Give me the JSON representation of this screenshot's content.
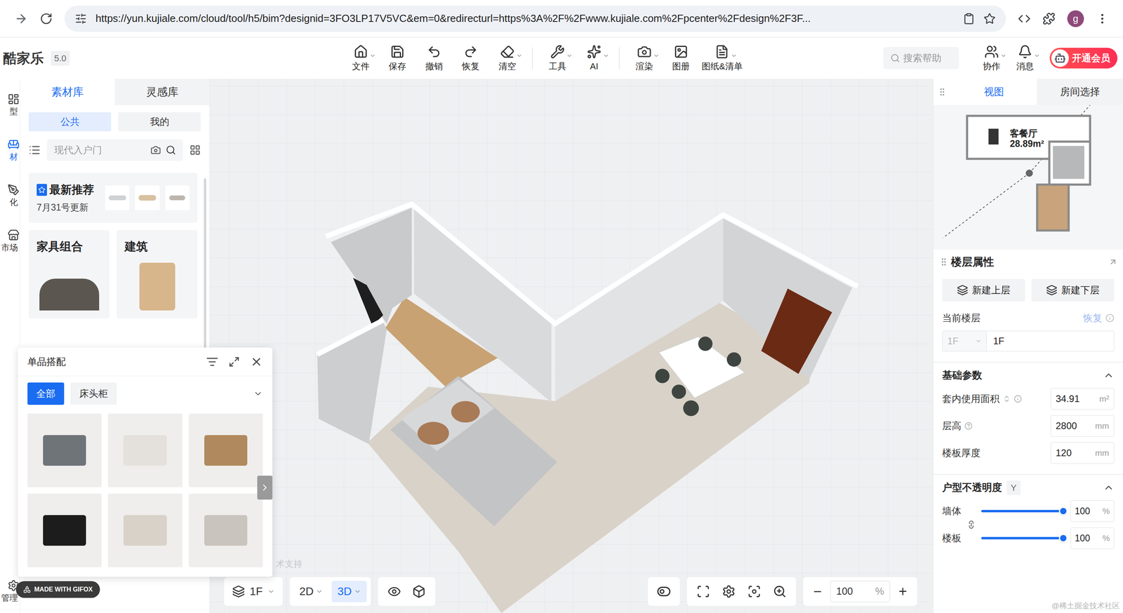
{
  "browser": {
    "url": "https://yun.kujiale.com/cloud/tool/h5/bim?designid=3FO3LP17V5VC&em=0&redirecturl=https%3A%2F%2Fwww.kujiale.com%2Fpcenter%2Fdesign%2F3F...",
    "avatar": "g"
  },
  "toolbar": {
    "logo": "酷家乐",
    "version": "5.0",
    "groups": [
      [
        {
          "label": "文件",
          "dropdown": true
        },
        {
          "label": "保存",
          "dropdown": false
        },
        {
          "label": "撤销",
          "dropdown": false
        },
        {
          "label": "恢复",
          "dropdown": false
        },
        {
          "label": "清空",
          "dropdown": true
        }
      ],
      [
        {
          "label": "工具",
          "dropdown": true
        },
        {
          "label": "AI",
          "dropdown": true
        }
      ],
      [
        {
          "label": "渲染",
          "dropdown": true
        },
        {
          "label": "图册",
          "dropdown": false
        },
        {
          "label": "图纸&清单",
          "dropdown": true
        }
      ]
    ],
    "search": {
      "placeholder": "搜索帮助"
    },
    "right_items": [
      {
        "label": "协作",
        "dropdown": true
      },
      {
        "label": "消息",
        "dropdown": true
      }
    ],
    "vip": "开通会员"
  },
  "rail": [
    {
      "label": "型",
      "selected": false
    },
    {
      "label": "材",
      "selected": true
    },
    {
      "label": "化",
      "selected": false
    },
    {
      "label": "市场",
      "selected": false
    },
    {
      "label": "管理",
      "selected": false
    }
  ],
  "left_panel": {
    "tabs": [
      {
        "label": "素材库",
        "selected": true
      },
      {
        "label": "灵感库",
        "selected": false
      }
    ],
    "scopes": [
      {
        "label": "公共",
        "selected": true
      },
      {
        "label": "我的",
        "selected": false
      }
    ],
    "search": {
      "placeholder": "现代入户门"
    },
    "featured": {
      "title": "最新推荐",
      "subtitle": "7月31号更新"
    },
    "cards": [
      {
        "title": "家具组合"
      },
      {
        "title": "建筑"
      }
    ]
  },
  "popup": {
    "title": "单品搭配",
    "tabs": [
      {
        "label": "全部",
        "selected": true
      },
      {
        "label": "床头柜",
        "selected": false
      }
    ],
    "items": [
      {
        "color": "#6f7479"
      },
      {
        "color": "#e4e1dc"
      },
      {
        "color": "#b08a5e"
      },
      {
        "color": "#1c1c1c"
      },
      {
        "color": "#d8d2c9"
      },
      {
        "color": "#c9c4bd"
      }
    ]
  },
  "canvas": {
    "watermark": "术支持",
    "floor": "1F",
    "modes": [
      {
        "label": "2D",
        "selected": false
      },
      {
        "label": "3D",
        "selected": true
      }
    ],
    "zoom": {
      "minus": "−",
      "value": "100",
      "unit": "%",
      "plus": "+"
    }
  },
  "right_panel": {
    "tabs": [
      {
        "label": "视图",
        "selected": true
      },
      {
        "label": "房间选择",
        "selected": false
      }
    ],
    "minimap": {
      "room": "客餐厅",
      "area": "28.89m²"
    },
    "floor_props": {
      "title": "楼层属性",
      "buttons": [
        "新建上层",
        "新建下层"
      ],
      "current_label": "当前楼层",
      "restore": {
        "label": "恢复",
        "disabled": true
      },
      "floor_select": {
        "value": "1F",
        "disabled": true
      },
      "floor_name": "1F"
    },
    "basic": {
      "title": "基础参数",
      "expanded": true,
      "fields": [
        {
          "label": "套内使用面积",
          "value": "34.91",
          "unit": "m²"
        },
        {
          "label": "层高",
          "value": "2800",
          "unit": "mm"
        },
        {
          "label": "楼板厚度",
          "value": "120",
          "unit": "mm"
        }
      ]
    },
    "opacity": {
      "title": "户型不透明度",
      "shortcut": "Y",
      "expanded": true,
      "sliders": [
        {
          "label": "墙体",
          "level": 1,
          "value": "100",
          "unit": "%"
        },
        {
          "label": "楼板",
          "level": 1,
          "value": "100",
          "unit": "%"
        }
      ]
    }
  },
  "watermarks": {
    "gifox": "MADE WITH GIFOX",
    "site": "@稀土掘金技术社区"
  }
}
